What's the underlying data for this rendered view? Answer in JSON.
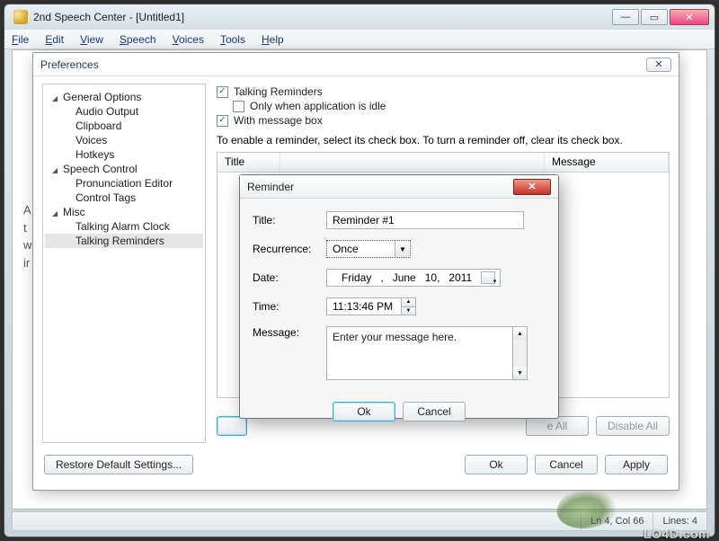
{
  "window": {
    "title": "2nd Speech Center - [Untitled1]"
  },
  "menubar": [
    "File",
    "Edit",
    "View",
    "Speech",
    "Voices",
    "Tools",
    "Help"
  ],
  "background_text": "A\nt\nw\nir",
  "preferences": {
    "title": "Preferences",
    "tree": {
      "general": {
        "label": "General Options",
        "children": [
          "Audio Output",
          "Clipboard",
          "Voices",
          "Hotkeys"
        ]
      },
      "speech": {
        "label": "Speech Control",
        "children": [
          "Pronunciation Editor",
          "Control Tags"
        ]
      },
      "misc": {
        "label": "Misc",
        "children": [
          "Talking Alarm Clock",
          "Talking Reminders"
        ]
      },
      "selected": "Talking Reminders"
    },
    "checks": {
      "talking_reminders": {
        "label": "Talking Reminders",
        "checked": true
      },
      "only_idle": {
        "label": "Only when application is idle",
        "checked": false
      },
      "with_msgbox": {
        "label": "With message box",
        "checked": true
      }
    },
    "hint": "To enable a reminder, select its check box. To turn a reminder off, clear its check box.",
    "grid_headers": {
      "title": "Title",
      "message": "Message"
    },
    "row_buttons": {
      "enable_all_suffix": "e All",
      "disable_all": "Disable All"
    },
    "footer": {
      "restore": "Restore Default Settings...",
      "ok": "Ok",
      "cancel": "Cancel",
      "apply": "Apply"
    }
  },
  "reminder": {
    "dialog_title": "Reminder",
    "labels": {
      "title": "Title:",
      "recurrence": "Recurrence:",
      "date": "Date:",
      "time": "Time:",
      "message": "Message:"
    },
    "values": {
      "title": "Reminder #1",
      "recurrence": "Once",
      "date": {
        "weekday": "Friday",
        "sep": ",",
        "month": "June",
        "day": "10,",
        "year": "2011"
      },
      "time": "11:13:46 PM",
      "message": "Enter your message here."
    },
    "buttons": {
      "ok": "Ok",
      "cancel": "Cancel"
    }
  },
  "statusbar": {
    "pos": "Ln 4, Col 66",
    "lines": "Lines: 4"
  },
  "watermark": "LO4D.com"
}
